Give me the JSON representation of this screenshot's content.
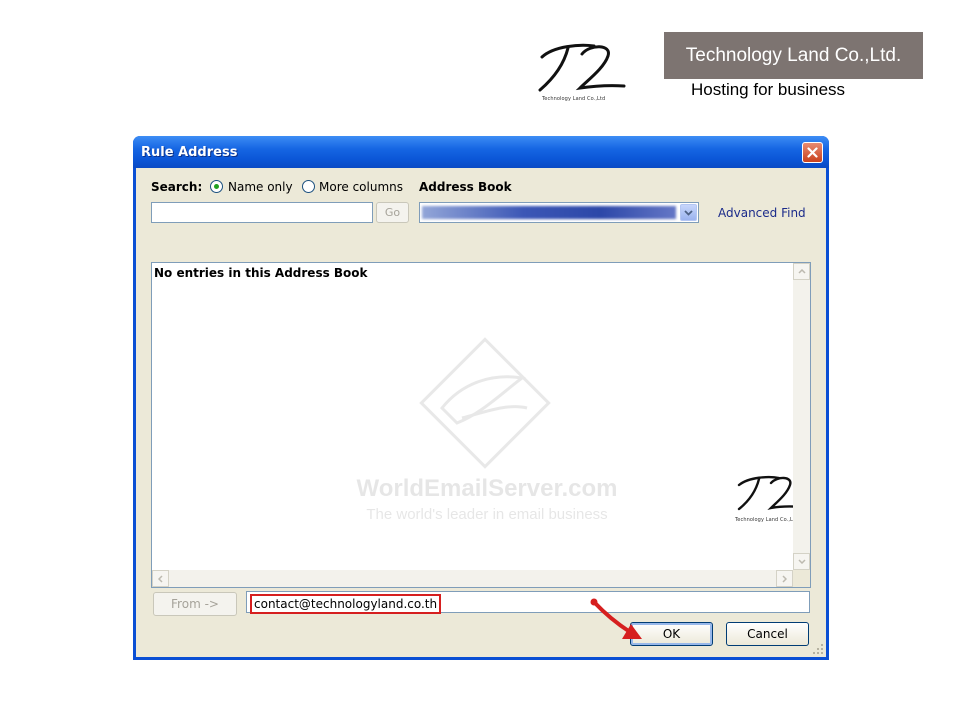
{
  "header": {
    "logo_caption": "Technology Land Co.,Ltd",
    "brand_name": "Technology Land Co.,Ltd.",
    "tagline": "Hosting for business"
  },
  "dialog": {
    "title": "Rule Address",
    "search": {
      "label": "Search:",
      "option_name_only": "Name only",
      "option_more_columns": "More columns",
      "selected_option": "Name only",
      "input_value": "",
      "go_label": "Go"
    },
    "address_book": {
      "label": "Address Book",
      "selected_value": ""
    },
    "advanced_find_label": "Advanced Find",
    "list": {
      "empty_message": "No entries in this Address Book"
    },
    "watermark": {
      "line1": "WorldEmailServer.com",
      "line2": "The world's leader in email business"
    },
    "list_logo_caption": "Technology Land Co.,Ltd",
    "from_button_label": "From ->",
    "from_value": "contact@technologyland.co.th",
    "ok_label": "OK",
    "cancel_label": "Cancel"
  },
  "colors": {
    "titlebar": "#0a4fd4",
    "dialog_bg": "#ece9d8",
    "brand_box": "#7d7471",
    "highlight": "#d61f1f",
    "link": "#1b2b8a"
  }
}
